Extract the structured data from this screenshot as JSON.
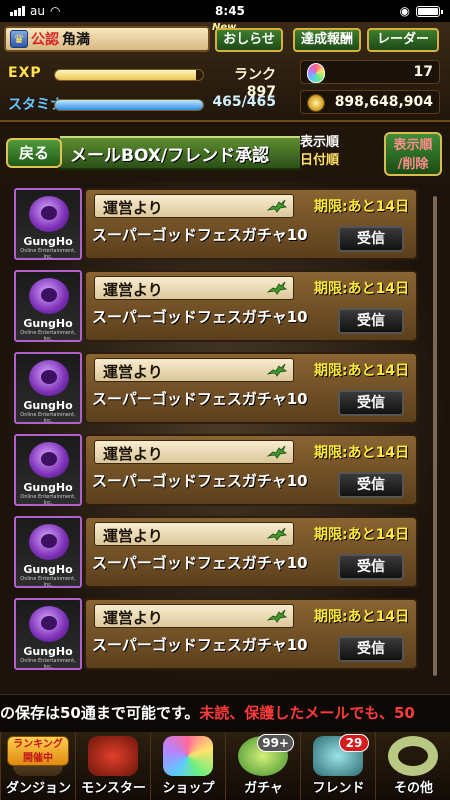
{
  "status_bar": {
    "carrier": "au",
    "time": "8:45"
  },
  "header": {
    "official_tag": "公認",
    "player_name": "角満",
    "new_tag": "New",
    "notice_button": "おしらせ",
    "achievement_button": "達成報酬",
    "radar_button": "レーダー",
    "exp_label": "EXP",
    "exp_progress": 0.95,
    "rank_text": "ランク 897",
    "stamina_label": "スタミナ",
    "stamina_progress": 1.0,
    "stamina_value": "465/465",
    "magic_stones": "17",
    "coins": "898,648,904"
  },
  "title_bar": {
    "back_button": "戻る",
    "title": "メールBOX/フレンド承認",
    "sort_label": "表示順",
    "sort_order": "日付順",
    "sort_delete_button_line1": "表示順",
    "sort_delete_button_line2": "/削除"
  },
  "mails": [
    {
      "logo": "GungHo",
      "logo_sub": "Online Entertainment, Inc.",
      "sender": "運営より",
      "deadline": "期限:あと14日",
      "subject": "スーパーゴッドフェスガチャ10",
      "action": "受信"
    },
    {
      "logo": "GungHo",
      "logo_sub": "Online Entertainment, Inc.",
      "sender": "運営より",
      "deadline": "期限:あと14日",
      "subject": "スーパーゴッドフェスガチャ10",
      "action": "受信"
    },
    {
      "logo": "GungHo",
      "logo_sub": "Online Entertainment, Inc.",
      "sender": "運営より",
      "deadline": "期限:あと14日",
      "subject": "スーパーゴッドフェスガチャ10",
      "action": "受信"
    },
    {
      "logo": "GungHo",
      "logo_sub": "Online Entertainment, Inc.",
      "sender": "運営より",
      "deadline": "期限:あと14日",
      "subject": "スーパーゴッドフェスガチャ10",
      "action": "受信"
    },
    {
      "logo": "GungHo",
      "logo_sub": "Online Entertainment, Inc.",
      "sender": "運営より",
      "deadline": "期限:あと14日",
      "subject": "スーパーゴッドフェスガチャ10",
      "action": "受信"
    },
    {
      "logo": "GungHo",
      "logo_sub": "Online Entertainment, Inc.",
      "sender": "運営より",
      "deadline": "期限:あと14日",
      "subject": "スーパーゴッドフェスガチャ10",
      "action": "受信"
    }
  ],
  "ticker": {
    "white_text": "の保存は50通まで可能です。",
    "red_text": "未読、保護したメールでも、50"
  },
  "nav": {
    "ranking_tag_line1": "ランキング",
    "ranking_tag_line2": "開催中",
    "dungeon": "ダンジョン",
    "monster": "モンスター",
    "shop": "ショップ",
    "gacha": "ガチャ",
    "gacha_badge": "99+",
    "friend": "フレンド",
    "friend_badge": "29",
    "other": "その他"
  },
  "colors": {
    "deadline": "#ffe93b",
    "ticker_red": "#ff3b3b",
    "accent_green": "#3d7f2e"
  }
}
